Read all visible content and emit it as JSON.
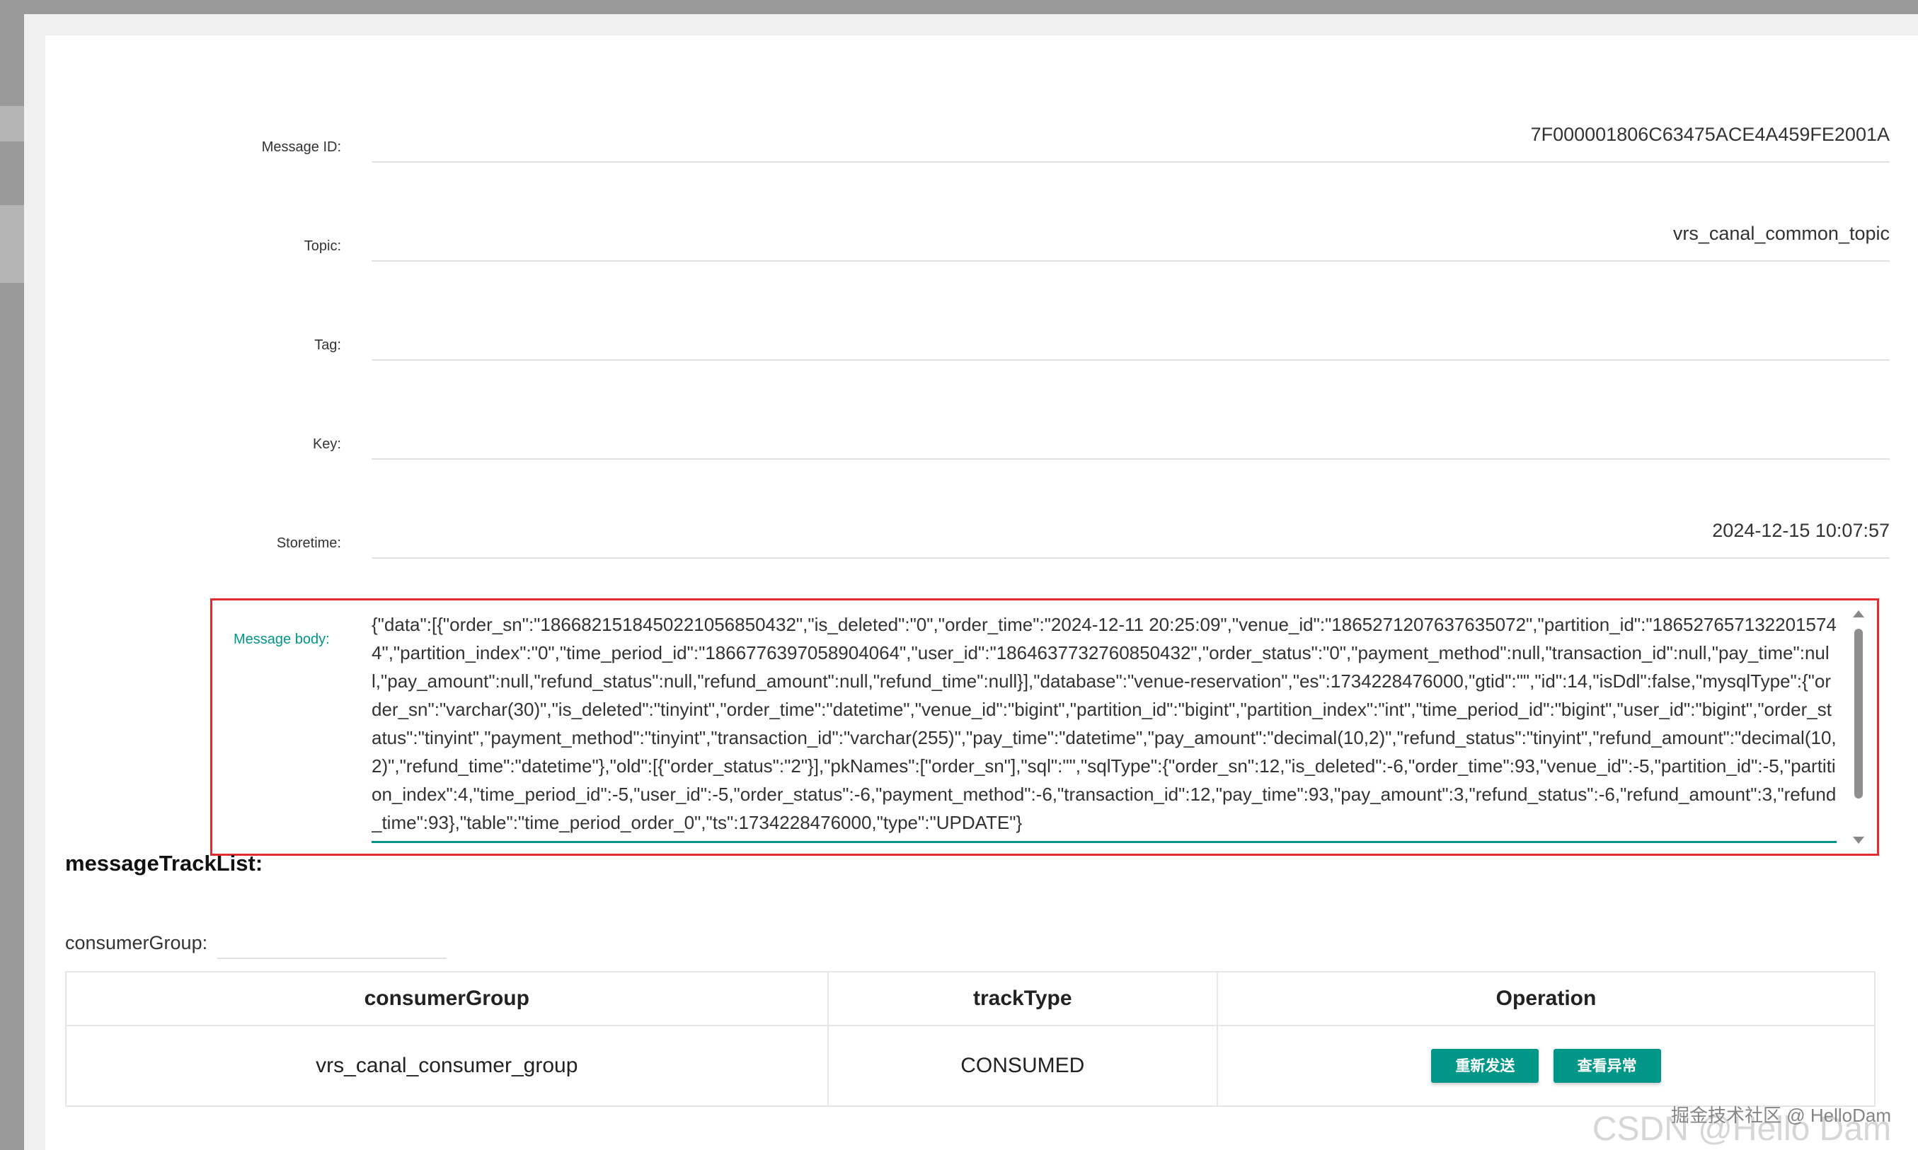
{
  "dialog": {
    "close_glyph": "×"
  },
  "fields": [
    {
      "label": "Message ID:",
      "value": "7F000001806C63475ACE4A459FE2001A"
    },
    {
      "label": "Topic:",
      "value": "vrs_canal_common_topic"
    },
    {
      "label": "Tag:",
      "value": ""
    },
    {
      "label": "Key:",
      "value": ""
    },
    {
      "label": "Storetime:",
      "value": "2024-12-15 10:07:57"
    }
  ],
  "message_body": {
    "label": "Message body:",
    "text": "{\"data\":[{\"order_sn\":\"1866821518450221056850432\",\"is_deleted\":\"0\",\"order_time\":\"2024-12-11 20:25:09\",\"venue_id\":\"1865271207637635072\",\"partition_id\":\"1865276571322015744\",\"partition_index\":\"0\",\"time_period_id\":\"1866776397058904064\",\"user_id\":\"1864637732760850432\",\"order_status\":\"0\",\"payment_method\":null,\"transaction_id\":null,\"pay_time\":null,\"pay_amount\":null,\"refund_status\":null,\"refund_amount\":null,\"refund_time\":null}],\"database\":\"venue-reservation\",\"es\":1734228476000,\"gtid\":\"\",\"id\":14,\"isDdl\":false,\"mysqlType\":{\"order_sn\":\"varchar(30)\",\"is_deleted\":\"tinyint\",\"order_time\":\"datetime\",\"venue_id\":\"bigint\",\"partition_id\":\"bigint\",\"partition_index\":\"int\",\"time_period_id\":\"bigint\",\"user_id\":\"bigint\",\"order_status\":\"tinyint\",\"payment_method\":\"tinyint\",\"transaction_id\":\"varchar(255)\",\"pay_time\":\"datetime\",\"pay_amount\":\"decimal(10,2)\",\"refund_status\":\"tinyint\",\"refund_amount\":\"decimal(10,2)\",\"refund_time\":\"datetime\"},\"old\":[{\"order_status\":\"2\"}],\"pkNames\":[\"order_sn\"],\"sql\":\"\",\"sqlType\":{\"order_sn\":12,\"is_deleted\":-6,\"order_time\":93,\"venue_id\":-5,\"partition_id\":-5,\"partition_index\":4,\"time_period_id\":-5,\"user_id\":-5,\"order_status\":-6,\"payment_method\":-6,\"transaction_id\":12,\"pay_time\":93,\"pay_amount\":3,\"refund_status\":-6,\"refund_amount\":3,\"refund_time\":93},\"table\":\"time_period_order_0\",\"ts\":1734228476000,\"type\":\"UPDATE\"}"
  },
  "track_list": {
    "title": "messageTrackList:",
    "filter_label": "consumerGroup:",
    "filter_value": "",
    "columns": [
      "consumerGroup",
      "trackType",
      "Operation"
    ],
    "rows": [
      {
        "consumerGroup": "vrs_canal_consumer_group",
        "trackType": "CONSUMED",
        "buttons": [
          "重新发送",
          "查看异常"
        ]
      }
    ]
  },
  "watermark": {
    "line1": "掘金技术社区 @ HelloDam",
    "line2": "CSDN @Hello Dam"
  },
  "colors": {
    "accent": "#009688",
    "highlight_border": "#e02c2c"
  }
}
